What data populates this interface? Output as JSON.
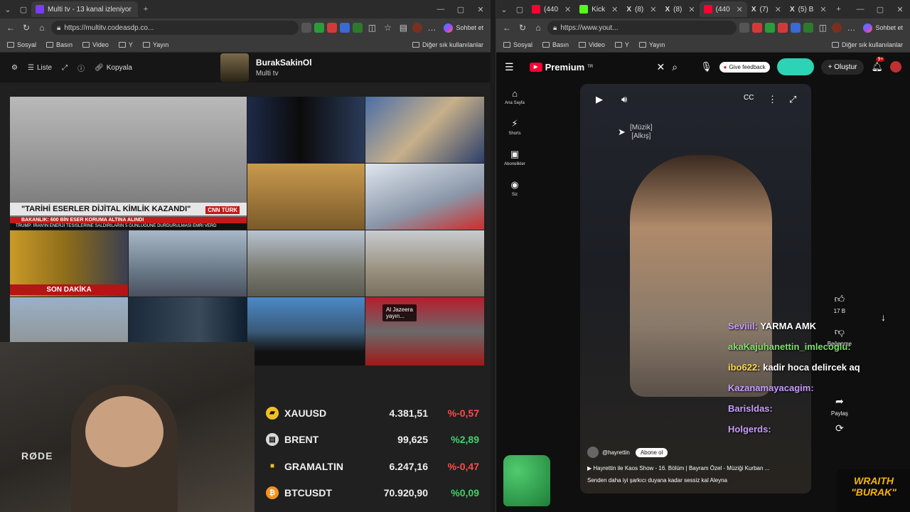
{
  "left": {
    "tab_title": "Multi tv - 13 kanal izleniyor",
    "url": "https://multitv.codeasdp.co...",
    "chat_label": "Sohbet et",
    "bookmarks": [
      "Sosyal",
      "Basın",
      "Video",
      "Y",
      "Yayın"
    ],
    "bookmarks_other": "Diğer sık kullanılanlar",
    "toolbar": {
      "list_label": "Liste",
      "copy_label": "Kopyala"
    },
    "channel": {
      "name": "BurakSakinOl",
      "subtitle": "Multi tv"
    },
    "headline": "\"TARİHİ ESERLER DİJİTAL KİMLİK KAZANDI\"",
    "headline_sub": "BAKANLIK: 600 BİN ESER KORUMA ALTINA ALINDI",
    "ticker": "TRUMP: İRAN'IN ENERJİ TESİSLERİNE SALDIRILARIN 5 GÜNLÜĞÜNE DURDURULMASI EMRİ VERD",
    "cnn_logo": "CNN TÜRK",
    "son_dakika": "SON DAKİKA",
    "aljazeera_label": "Al Jazeera\nyayın...",
    "markets": [
      {
        "name": "XAUUSD",
        "price": "4.381,51",
        "change": "%-0,57",
        "dir": "neg",
        "icon": "gold-icon"
      },
      {
        "name": "BRENT",
        "price": "99,625",
        "change": "%2,89",
        "dir": "pos",
        "icon": "oil-icon"
      },
      {
        "name": "GRAMALTIN",
        "price": "6.247,16",
        "change": "%-0,47",
        "dir": "neg",
        "icon": "gram-gold-icon"
      },
      {
        "name": "BTCUSDT",
        "price": "70.920,90",
        "change": "%0,09",
        "dir": "pos",
        "icon": "bitcoin-icon"
      }
    ],
    "webcam_mic_label": "RØDE"
  },
  "right": {
    "tabs": [
      "(440",
      "Kick",
      "(8)",
      "(8)",
      "(440",
      "(7)",
      "(5) B"
    ],
    "url": "https://www.yout...",
    "chat_label": "Sohbet et",
    "bookmarks": [
      "Sosyal",
      "Basın",
      "Video",
      "Y",
      "Yayın"
    ],
    "bookmarks_other": "Diğer sık kullanılanlar",
    "yt": {
      "logo": "Premium",
      "logo_country": "TR",
      "feedback": "Give feedback",
      "create": "Oluştur",
      "notifications": "9+",
      "sidebar": [
        "Ana Sayfa",
        "Shorts",
        "Abonelikler",
        "Siz"
      ],
      "muzik": "[Müzik]\n[Alkış]",
      "likes": "17 B",
      "dislike": "Beğenme",
      "share": "Paylaş",
      "channel": "@hayrettin",
      "subscribe": "Abone ol",
      "playlist": "Hayrettin ile Kaos Show - 16. Bölüm | Bayram Özel - Müziği Kurban ...",
      "caption": "Senden daha iyi şarkıcı duyana kadar sessiz kal Aleyna"
    },
    "chat": [
      {
        "user": "Seviiil:",
        "msg": "YARMA AMK",
        "color": "p"
      },
      {
        "user": "akaKajuhanettin_imlecoglu:",
        "msg": "",
        "color": "g"
      },
      {
        "user": "ibo622:",
        "msg": "kadir hoca delircek aq",
        "color": ""
      },
      {
        "user": "Kazanamayacagim:",
        "msg": "",
        "color": "p"
      },
      {
        "user": "Barisldas:",
        "msg": "",
        "color": "p"
      },
      {
        "user": "Holgerds:",
        "msg": "",
        "color": "p"
      }
    ],
    "overlay_brand": "WRAITH\n\"BURAK\""
  }
}
